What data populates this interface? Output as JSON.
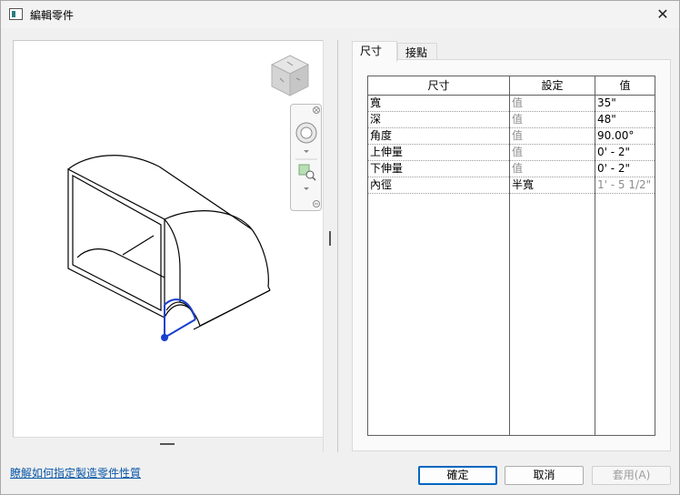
{
  "window": {
    "title": "編輯零件"
  },
  "tabs": [
    {
      "label": "尺寸",
      "active": true
    },
    {
      "label": "接點",
      "active": false
    }
  ],
  "grid": {
    "columns": [
      "尺寸",
      "設定",
      "值"
    ],
    "rows": [
      {
        "name": "寬",
        "setting": "值",
        "value": "35\""
      },
      {
        "name": "深",
        "setting": "值",
        "value": "48\""
      },
      {
        "name": "角度",
        "setting": "值",
        "value": "90.00°"
      },
      {
        "name": "上伸量",
        "setting": "值",
        "value": "0' - 2\""
      },
      {
        "name": "下伸量",
        "setting": "值",
        "value": "0' - 2\""
      },
      {
        "name": "內徑",
        "setting": "半寬",
        "value": "1' - 5 1/2\""
      }
    ]
  },
  "footer": {
    "help_link": "瞭解如何指定製造零件性質",
    "ok_label": "確定",
    "cancel_label": "取消",
    "apply_label": "套用(A)"
  },
  "colors": {
    "accent": "#0067c0",
    "link": "#0a57a6",
    "connector": "#1a3fd1"
  },
  "icons": [
    "view-cube-icon",
    "steering-wheel-icon",
    "zoom-region-icon",
    "close-icon"
  ]
}
